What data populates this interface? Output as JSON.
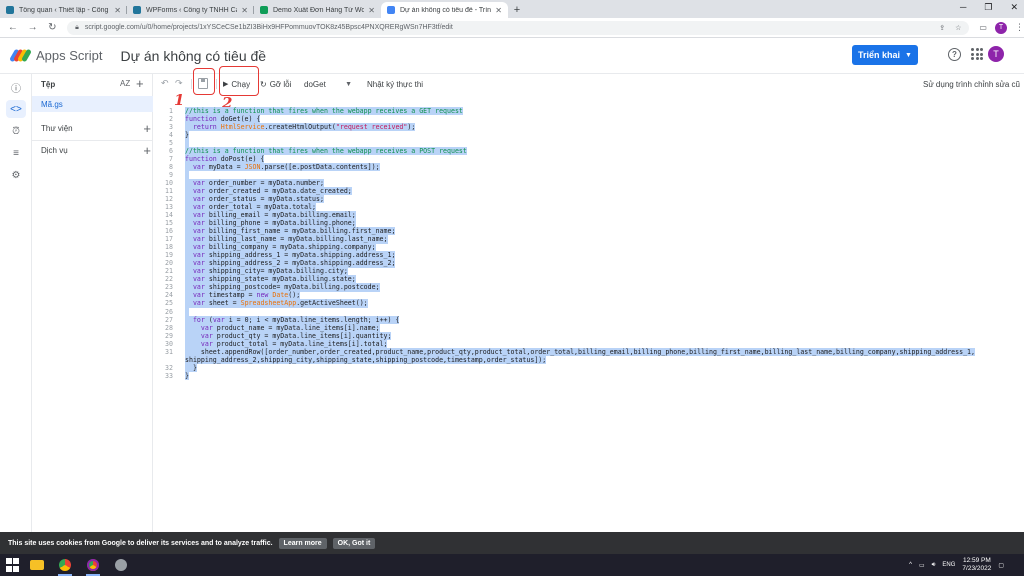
{
  "browser": {
    "tabs": [
      {
        "title": "Tổng quan ‹ Thiết lập - Công ty",
        "favicon_color": "#21759b",
        "active": false
      },
      {
        "title": "WPForms ‹ Công ty TNHH Cát Tí",
        "favicon_color": "#21759b",
        "active": false
      },
      {
        "title": "Demo Xuất Đơn Hàng Từ Wooco",
        "favicon_color": "#0f9d58",
        "active": false
      },
      {
        "title": "Dự án không có tiêu đề - Trình c",
        "favicon_color": "#4285f4",
        "active": true
      }
    ],
    "new_tab": "+",
    "url": "script.google.com/u/0/home/projects/1xYSCeCSe1bZI3BiHx9HFPommuovTOK8z45Bpsc4PNXQRERgWSn7HF3tf/edit",
    "profile_initial": "T"
  },
  "app": {
    "name": "Apps Script",
    "project_title": "Dự án không có tiêu đề",
    "deploy_label": "Triển khai",
    "user_initial": "T",
    "logo_colors": [
      "#4285f4",
      "#ea4335",
      "#fbbc04",
      "#34a853"
    ]
  },
  "files_panel": {
    "header": "Tệp",
    "sort_icon": "AZ",
    "file": "Mã.gs",
    "sections": [
      {
        "label": "Thư viện"
      },
      {
        "label": "Dịch vụ"
      }
    ]
  },
  "toolbar": {
    "run_label": "Chạy",
    "debug_label": "Gỡ lỗi",
    "function_name": "doGet",
    "exec_log_label": "Nhật ký thực thi",
    "legacy_label": "Sử dụng trình chỉnh sửa cũ"
  },
  "annotations": {
    "one": "1",
    "two": "2",
    "color": "#e53935"
  },
  "code_lines": [
    {
      "n": "1",
      "text": "//this is a function that fires when the webapp receives a GET request",
      "cls": "c-com"
    },
    {
      "n": "2",
      "text": "function doGet(e) {",
      "cls": ""
    },
    {
      "n": "3",
      "text": "  return HtmlService.createHtmlOutput(\"request received\");",
      "cls": ""
    },
    {
      "n": "4",
      "text": "}",
      "cls": ""
    },
    {
      "n": "5",
      "text": " ",
      "cls": ""
    },
    {
      "n": "6",
      "text": "//this is a function that fires when the webapp receives a POST request",
      "cls": "c-com"
    },
    {
      "n": "7",
      "text": "function doPost(e) {",
      "cls": ""
    },
    {
      "n": "8",
      "text": "  var myData = JSON.parse([e.postData.contents]);",
      "cls": ""
    },
    {
      "n": "9",
      "text": " ",
      "cls": ""
    },
    {
      "n": "10",
      "text": "  var order_number = myData.number;",
      "cls": ""
    },
    {
      "n": "11",
      "text": "  var order_created = myData.date_created;",
      "cls": ""
    },
    {
      "n": "12",
      "text": "  var order_status = myData.status;",
      "cls": ""
    },
    {
      "n": "13",
      "text": "  var order_total = myData.total;",
      "cls": ""
    },
    {
      "n": "14",
      "text": "  var billing_email = myData.billing.email;",
      "cls": ""
    },
    {
      "n": "15",
      "text": "  var billing_phone = myData.billing.phone;",
      "cls": ""
    },
    {
      "n": "16",
      "text": "  var billing_first_name = myData.billing.first_name;",
      "cls": ""
    },
    {
      "n": "17",
      "text": "  var billing_last_name = myData.billing.last_name;",
      "cls": ""
    },
    {
      "n": "18",
      "text": "  var billing_company = myData.shipping.company;",
      "cls": ""
    },
    {
      "n": "19",
      "text": "  var shipping_address_1 = myData.shipping.address_1;",
      "cls": ""
    },
    {
      "n": "20",
      "text": "  var shipping_address_2 = myData.shipping.address_2;",
      "cls": ""
    },
    {
      "n": "21",
      "text": "  var shipping_city= myData.billing.city;",
      "cls": ""
    },
    {
      "n": "22",
      "text": "  var shipping_state= myData.billing.state;",
      "cls": ""
    },
    {
      "n": "23",
      "text": "  var shipping_postcode= myData.billing.postcode;",
      "cls": ""
    },
    {
      "n": "24",
      "text": "  var timestamp = new Date();",
      "cls": ""
    },
    {
      "n": "25",
      "text": "  var sheet = SpreadsheetApp.getActiveSheet();",
      "cls": ""
    },
    {
      "n": "26",
      "text": " ",
      "cls": ""
    },
    {
      "n": "27",
      "text": "  for (var i = 0; i < myData.line_items.length; i++) {",
      "cls": ""
    },
    {
      "n": "28",
      "text": "    var product_name = myData.line_items[i].name;",
      "cls": ""
    },
    {
      "n": "29",
      "text": "    var product_qty = myData.line_items[i].quantity;",
      "cls": ""
    },
    {
      "n": "30",
      "text": "    var product_total = myData.line_items[i].total;",
      "cls": ""
    },
    {
      "n": "31",
      "text": "    sheet.appendRow([order_number,order_created,product_name,product_qty,product_total,order_total,billing_email,billing_phone,billing_first_name,billing_last_name,billing_company,shipping_address_1,",
      "cls": ""
    },
    {
      "n": "",
      "text": "shipping_address_2,shipping_city,shipping_state,shipping_postcode,timestamp,order_status]);",
      "cls": ""
    },
    {
      "n": "32",
      "text": "  }",
      "cls": ""
    },
    {
      "n": "33",
      "text": "}",
      "cls": ""
    }
  ],
  "cookie_bar": {
    "text": "This site uses cookies from Google to deliver its services and to analyze traffic.",
    "learn_more": "Learn more",
    "ok": "OK, Got it"
  },
  "taskbar": {
    "lang": "ENG",
    "time": "12:59 PM",
    "date": "7/23/2022"
  }
}
